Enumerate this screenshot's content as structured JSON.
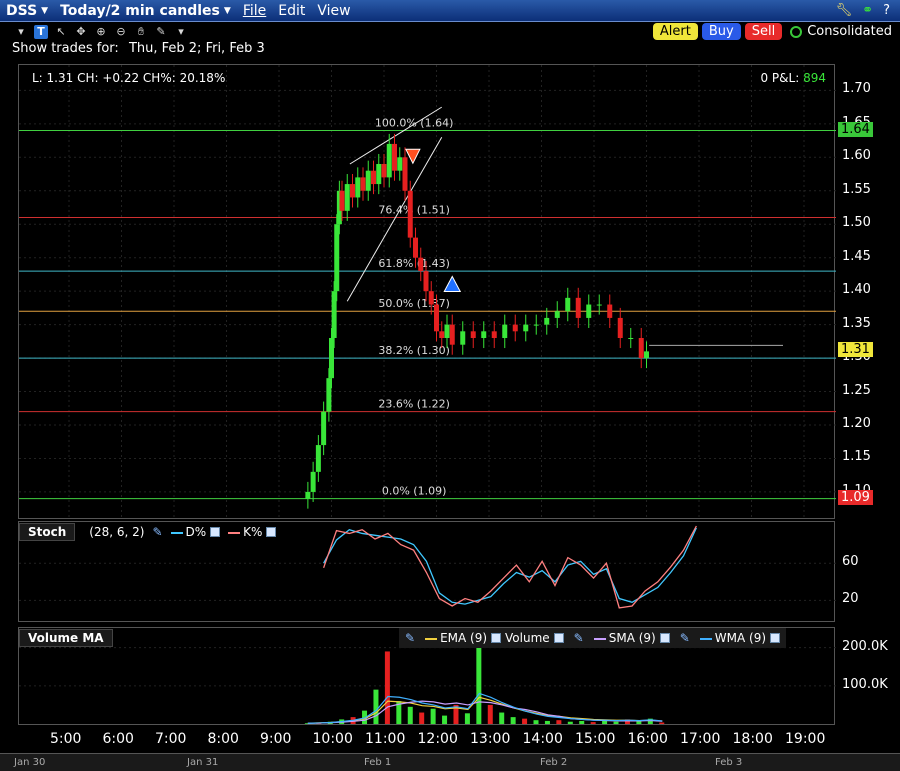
{
  "menu": {
    "symbol": "DSS",
    "timeframe": "Today/2 min candles",
    "file": "File",
    "edit": "Edit",
    "view": "View"
  },
  "toolbar": {
    "alert": "Alert",
    "buy": "Buy",
    "sell": "Sell",
    "consolidated": "Consolidated",
    "t_button": "T"
  },
  "trades": {
    "label": "Show trades for:",
    "days": "Thu, Feb 2; Fri, Feb 3"
  },
  "price_panel": {
    "info": "L: 1.31 CH: +0.22 CH%: 20.18%",
    "position": "0 P&L:",
    "pnl_value": "894",
    "current_tag": "1.31",
    "high_tag": "1.64",
    "low_tag": "1.09"
  },
  "stoch_panel": {
    "name": "Stoch",
    "params": "(28, 6, 2)",
    "d_label": "D%",
    "k_label": "K%"
  },
  "volume_panel": {
    "name": "Volume MA",
    "ema": "EMA (9)",
    "volume": "Volume",
    "sma": "SMA (9)",
    "wma": "WMA (9)"
  },
  "colors": {
    "up": "#39e639",
    "down": "#e62020",
    "ema": "#f0d040",
    "sma": "#c8a0ff",
    "wma": "#40b0ff",
    "d_line": "#40c8ff",
    "k_line": "#ff8080"
  },
  "time_labels": [
    "5:00",
    "6:00",
    "7:00",
    "8:00",
    "9:00",
    "10:00",
    "11:00",
    "12:00",
    "13:00",
    "14:00",
    "15:00",
    "16:00",
    "17:00",
    "18:00",
    "19:00"
  ],
  "date_labels": [
    "Jan 30",
    "Jan 31",
    "Feb 1",
    "Feb 2",
    "Feb 3"
  ],
  "chart_data": [
    {
      "type": "candlestick",
      "title": "DSS Today/2 min candles",
      "y_ticks": [
        "1.70",
        "1.65",
        "1.60",
        "1.55",
        "1.50",
        "1.45",
        "1.40",
        "1.35",
        "1.30",
        "1.25",
        "1.20",
        "1.15",
        "1.10"
      ],
      "ylim": [
        1.07,
        1.72
      ],
      "fib_levels": [
        {
          "label": "100.0% (1.64)",
          "value": 1.64,
          "color": "#40d040"
        },
        {
          "label": "76.4% (1.51)",
          "value": 1.51,
          "color": "#d03030"
        },
        {
          "label": "61.8% (1.43)",
          "value": 1.43,
          "color": "#40b8c8"
        },
        {
          "label": "50.0% (1.37)",
          "value": 1.37,
          "color": "#e0a040"
        },
        {
          "label": "38.2% (1.30)",
          "value": 1.3,
          "color": "#40b8c8"
        },
        {
          "label": "23.6% (1.22)",
          "value": 1.22,
          "color": "#d03030"
        },
        {
          "label": "0.0% (1.09)",
          "value": 1.09,
          "color": "#40d040"
        }
      ],
      "x": [
        9.55,
        9.65,
        9.75,
        9.85,
        9.95,
        10.0,
        10.05,
        10.1,
        10.15,
        10.2,
        10.3,
        10.4,
        10.5,
        10.6,
        10.7,
        10.8,
        10.9,
        11.0,
        11.1,
        11.2,
        11.3,
        11.4,
        11.5,
        11.6,
        11.7,
        11.8,
        11.9,
        12.0,
        12.1,
        12.2,
        12.3,
        12.5,
        12.7,
        12.9,
        13.1,
        13.3,
        13.5,
        13.7,
        13.9,
        14.1,
        14.3,
        14.5,
        14.7,
        14.9,
        15.1,
        15.3,
        15.5,
        15.7,
        15.9,
        16.0
      ],
      "close": [
        1.1,
        1.13,
        1.17,
        1.22,
        1.27,
        1.33,
        1.4,
        1.5,
        1.55,
        1.52,
        1.56,
        1.54,
        1.57,
        1.55,
        1.58,
        1.56,
        1.59,
        1.57,
        1.62,
        1.58,
        1.6,
        1.55,
        1.48,
        1.45,
        1.43,
        1.4,
        1.38,
        1.34,
        1.33,
        1.35,
        1.32,
        1.34,
        1.33,
        1.34,
        1.33,
        1.35,
        1.34,
        1.35,
        1.35,
        1.36,
        1.37,
        1.39,
        1.36,
        1.38,
        1.38,
        1.36,
        1.33,
        1.33,
        1.3,
        1.31
      ],
      "markers": [
        {
          "kind": "sell",
          "x": 11.55,
          "price": 1.6
        },
        {
          "kind": "buy",
          "x": 12.3,
          "price": 1.41
        }
      ],
      "current": 1.31
    },
    {
      "type": "line",
      "title": "Stoch (28, 6, 2)",
      "y_ticks": [
        "60",
        "20"
      ],
      "ylim": [
        0,
        100
      ],
      "series": [
        {
          "name": "D%",
          "values": [
            60,
            85,
            96,
            92,
            90,
            88,
            86,
            80,
            62,
            28,
            18,
            16,
            20,
            24,
            38,
            50,
            45,
            52,
            40,
            58,
            62,
            48,
            54,
            22,
            18,
            26,
            34,
            50,
            68,
            98
          ]
        },
        {
          "name": "K%",
          "values": [
            55,
            95,
            92,
            96,
            86,
            92,
            80,
            74,
            50,
            22,
            14,
            22,
            18,
            30,
            44,
            58,
            40,
            62,
            36,
            66,
            58,
            44,
            60,
            12,
            14,
            30,
            40,
            56,
            74,
            100
          ]
        }
      ]
    },
    {
      "type": "bar",
      "title": "Volume MA",
      "y_ticks": [
        "200.0K",
        "100.0K"
      ],
      "ylim": [
        0,
        220000
      ],
      "values": [
        2000,
        4000,
        6000,
        12000,
        18000,
        35000,
        90000,
        190000,
        60000,
        45000,
        30000,
        40000,
        22000,
        50000,
        28000,
        215000,
        50000,
        30000,
        18000,
        14000,
        10000,
        8000,
        10000,
        6000,
        8000,
        5000,
        9000,
        6000,
        12000,
        8000,
        14000,
        4000
      ],
      "series": [
        {
          "name": "EMA (9)",
          "values": [
            2000,
            3000,
            4000,
            6000,
            9000,
            14000,
            30000,
            60000,
            58000,
            55000,
            48000,
            46000,
            40000,
            42000,
            38000,
            70000,
            62000,
            52000,
            42000,
            34000,
            28000,
            22000,
            20000,
            16000,
            14000,
            12000,
            11000,
            10000,
            10000,
            9000,
            10000,
            8000
          ]
        },
        {
          "name": "SMA (9)",
          "values": [
            2000,
            2500,
            3500,
            5000,
            7000,
            10000,
            22000,
            45000,
            52000,
            57000,
            60000,
            58000,
            52000,
            55000,
            50000,
            58000,
            56000,
            50000,
            42000,
            38000,
            32000,
            24000,
            20000,
            14000,
            12000,
            10000,
            9000,
            8000,
            8000,
            8000,
            9000,
            7000
          ]
        },
        {
          "name": "WMA (9)",
          "values": [
            2000,
            2800,
            4000,
            6500,
            10000,
            16000,
            36000,
            72000,
            70000,
            64000,
            55000,
            50000,
            42000,
            45000,
            40000,
            80000,
            70000,
            56000,
            44000,
            34000,
            26000,
            20000,
            17000,
            14000,
            12000,
            10000,
            10000,
            9000,
            10000,
            9000,
            11000,
            8000
          ]
        }
      ]
    }
  ]
}
